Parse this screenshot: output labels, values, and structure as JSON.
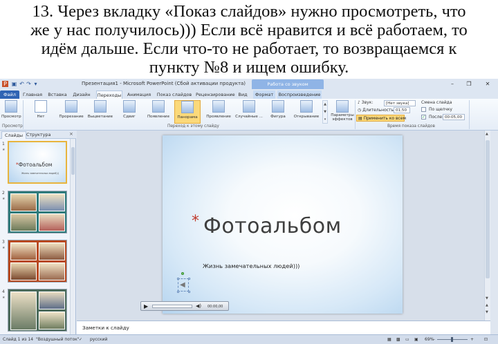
{
  "caption": {
    "lines": [
      "13. Через вкладку «Показ слайдов» нужно просмотреть, что",
      "же у нас получилось))) Если всё нравится и всё работаем, то",
      "идём дальше. Если что-то не работает, то возвращаемся к",
      "пункту №8 и ищем ошибку."
    ]
  },
  "window": {
    "title": "Презентация1 - Microsoft PowerPoint (Сбой активации продукта)",
    "context_group": "Работа со звуком",
    "controls": {
      "minimize": "–",
      "restore": "❐",
      "close": "✕"
    }
  },
  "tabs": [
    {
      "label": "Файл"
    },
    {
      "label": "Главная"
    },
    {
      "label": "Вставка"
    },
    {
      "label": "Дизайн"
    },
    {
      "label": "Переходы"
    },
    {
      "label": "Анимация"
    },
    {
      "label": "Показ слайдов"
    },
    {
      "label": "Рецензирование"
    },
    {
      "label": "Вид"
    },
    {
      "label": "Формат"
    },
    {
      "label": "Воспроизведение"
    }
  ],
  "ribbon": {
    "preview": {
      "label": "Просмотр",
      "group": "Просмотр"
    },
    "transitions": [
      {
        "label": "Нет"
      },
      {
        "label": "Прорезание"
      },
      {
        "label": "Выцветание"
      },
      {
        "label": "Сдвиг"
      },
      {
        "label": "Появление"
      },
      {
        "label": "Панорама"
      },
      {
        "label": "Проявление"
      },
      {
        "label": "Случайные ..."
      },
      {
        "label": "Фигура"
      },
      {
        "label": "Открывание"
      }
    ],
    "transitions_group": "Переход к этому слайду",
    "effects": {
      "label": "Параметры эффектов"
    },
    "timing": {
      "sound_label": "Звук:",
      "sound_value": "[Нет звука]",
      "duration_label": "Длительность:",
      "duration_value": "01,50",
      "apply_all": "Применить ко всем",
      "change_label": "Смена слайда",
      "on_click": "По щелчку",
      "after_label": "После:",
      "after_value": "00:05,00",
      "group": "Время показа слайдов"
    }
  },
  "left_pane": {
    "tabs": [
      "Слайды",
      "Структура"
    ],
    "close": "×",
    "slides": [
      {
        "num": "1",
        "title": "Фотоальбом",
        "subtitle": "Жизнь замечательных людей)))"
      },
      {
        "num": "2"
      },
      {
        "num": "3"
      },
      {
        "num": "4"
      }
    ]
  },
  "slide": {
    "title": "Фотоальбом",
    "subtitle": "Жизнь замечательных людей)))",
    "media_time": "00:00,00"
  },
  "notes": {
    "placeholder": "Заметки к слайду"
  },
  "status": {
    "slide_info": "Слайд 1 из 14",
    "theme": "\"Воздушный поток\"",
    "language": "русский",
    "zoom": "69%"
  },
  "colors": {
    "accent": "#2f64b4",
    "active_button": "#fbd97a",
    "title_star": "#c0392b"
  }
}
